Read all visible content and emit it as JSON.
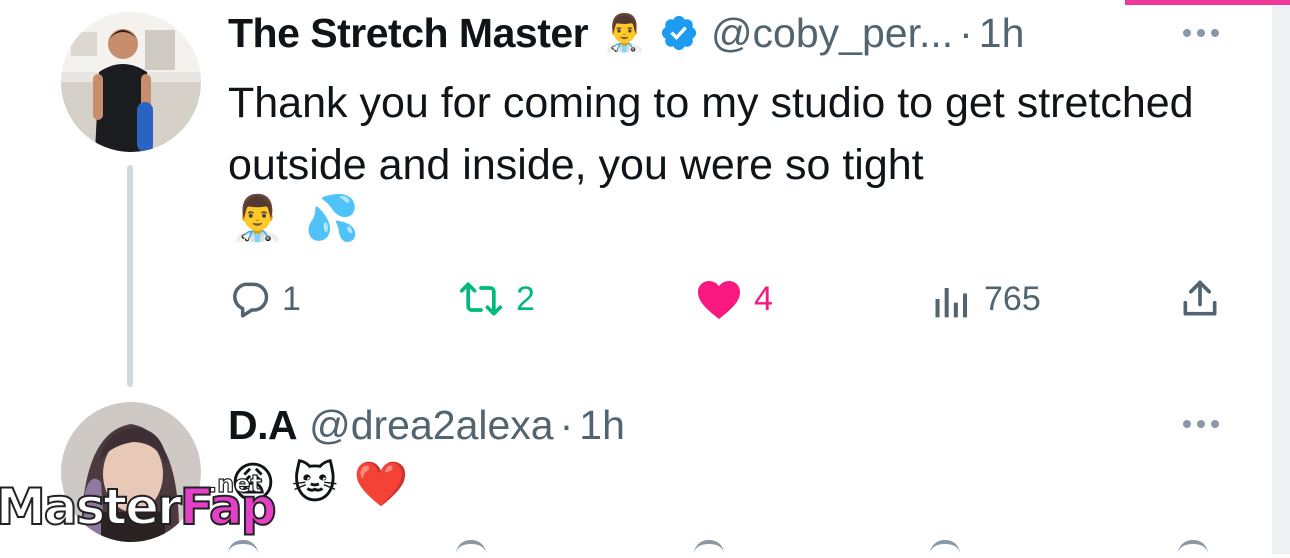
{
  "tweets": [
    {
      "display_name": "The Stretch Master",
      "name_emoji": "👨‍⚕️",
      "verified": true,
      "handle": "@coby_per...",
      "separator": "·",
      "time": "1h",
      "text": "Thank you for coming to my studio to get stretched outside and inside, you were so tight",
      "emojis": [
        "👨‍⚕️",
        "💦"
      ],
      "actions": {
        "replies": "1",
        "retweets": "2",
        "likes": "4",
        "views": "765"
      }
    },
    {
      "display_name": "D.A",
      "handle": "@drea2alexa",
      "separator": "·",
      "time": "1h",
      "emojis": [
        "😩",
        "🐱",
        "❤️"
      ]
    }
  ],
  "colors": {
    "retweet_active": "#00ba7c",
    "like_active": "#f91880",
    "verified_blue": "#1d9bf0",
    "secondary_text": "#536471"
  },
  "watermark": {
    "part1": "Master",
    "part2": "Fap",
    "suffix": ".net"
  }
}
